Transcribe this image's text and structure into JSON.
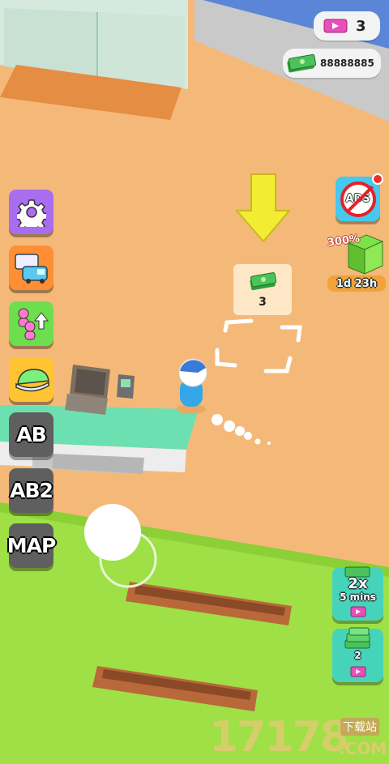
{
  "hud": {
    "tickets": "3",
    "cash": "88888885"
  },
  "side_menu": {
    "ab_label": "AB",
    "ab2_label": "AB2",
    "map_label": "MAP"
  },
  "right_menu": {
    "no_ads_label": "ADS",
    "offer_percent": "300%",
    "offer_timer": "1d 23h",
    "boost_multiplier": "2x",
    "boost_duration": "5 mins",
    "cash_pack_count": "2"
  },
  "cost_bubble": {
    "amount": "3"
  },
  "watermark": {
    "digits": "17178",
    "small": "下载站",
    "domain": ".COM"
  },
  "colors": {
    "floor": "#f4b979",
    "grass": "#9ee046",
    "counter": "#6de0b2",
    "arrow": "#f2ec33",
    "teal_button": "#45d4b9"
  }
}
